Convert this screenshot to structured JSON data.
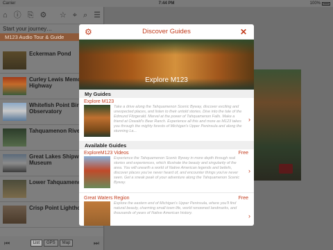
{
  "status_bar": {
    "carrier": "Carrier",
    "time": "7:44 PM",
    "battery": "100%"
  },
  "sidebar": {
    "toolbar_icons": {
      "home": "⌂",
      "info": "ⓘ",
      "share": "⎘",
      "settings": "⚙",
      "favorite": "☆",
      "location": "⌖",
      "search": "⌕",
      "menu": "☰"
    },
    "journey_label": "Start your journey…",
    "selected_header": "M123 Audio Tour & Guide",
    "items": [
      {
        "title": "Eckerman Pond"
      },
      {
        "title": "Curley Lewis Memo Highway"
      },
      {
        "title": "Whitefish Point Bir Observatory"
      },
      {
        "title": "Tahquamenon River Unit"
      },
      {
        "title": "Great Lakes Shipwr Museum"
      },
      {
        "title": "Lower Tahquamenon"
      },
      {
        "title": "Crisp Point Lighthouse"
      }
    ],
    "bottom": {
      "prev_icon": "⏮",
      "next_icon": "⏭",
      "segments": [
        "List",
        "GPS",
        "Map"
      ],
      "active_segment": "List"
    }
  },
  "modal": {
    "title": "Discover Guides",
    "gear_icon": "⚙",
    "close_icon": "✕",
    "hero_caption": "Explore M123",
    "my_guides_label": "My Guides",
    "available_guides_label": "Available Guides",
    "my_guides": [
      {
        "title": "Explore M123",
        "description": "Take a drive along the Tahquamenon Scenic Byway, discover exciting and unexpected places, and listen to their untold stories. Dive into the tale of the Edmund Fitzgerald. Marvel at the power of Tahquamenon Falls. Make a friend at Oswald's Bear Ranch. Experience all this and more as M123 takes you through the mighty forests of Michigan's Upper Peninsula and along the stunning La...",
        "chevron": "›"
      }
    ],
    "available_guides": [
      {
        "title": "ExploreM123 Videos",
        "price": "Free",
        "description": "Experience the Tahquamenon Scenic Byway in more depth through real stories and experiences, which illustrate the beauty and singularity of the area. You will unearth a world of Native American legends and beliefs, discover places you've never heard of, and encounter things you've never seen. Get a sneak peak of your adventure along the Tahquamenon Scenic Byway.",
        "chevron": "›"
      },
      {
        "title": "Great Waters Region",
        "price": "Free",
        "description": "Explore the eastern end of Michigan's Upper Peninsula, where you'll find natural beauty, charming small town life, world renowned landmarks, and thousands of years of Native American history.",
        "chevron": "›"
      }
    ]
  },
  "colors": {
    "accent": "#c23b1c",
    "selected_header": "#8e5a3a",
    "dimmed_bg": "#7e7e7e"
  }
}
